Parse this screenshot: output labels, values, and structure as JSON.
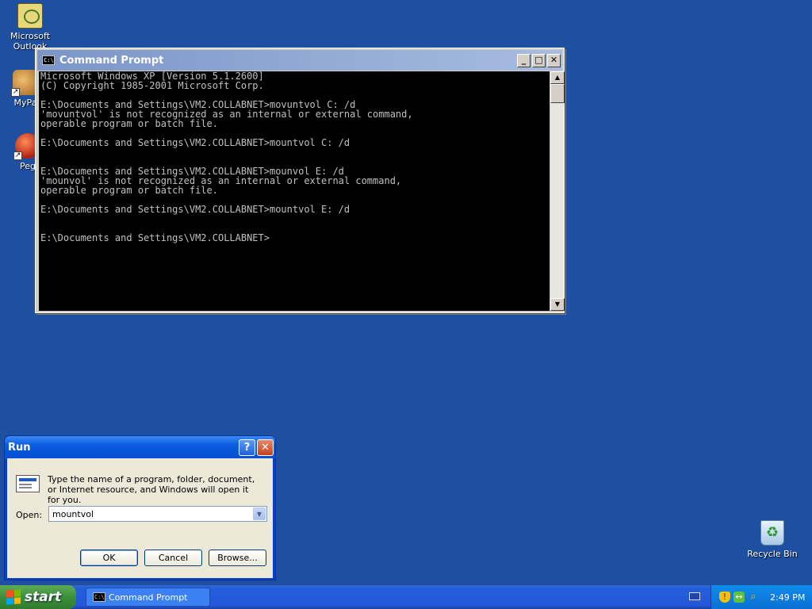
{
  "desktop": {
    "icons": [
      {
        "label": "Microsoft Outlook",
        "icon": "outlook-icon"
      },
      {
        "label": "MyPa",
        "icon": "shortcut-icon"
      },
      {
        "label": "Peg",
        "icon": "shortcut-icon"
      },
      {
        "label": "Recycle Bin",
        "icon": "recycle-bin-icon"
      }
    ]
  },
  "cmd_window": {
    "title": "Command Prompt",
    "icon_text": "C:\\",
    "buttons": {
      "minimize": "_",
      "maximize": "□",
      "close": "✕"
    },
    "output": "Microsoft Windows XP [Version 5.1.2600]\n(C) Copyright 1985-2001 Microsoft Corp.\n\nE:\\Documents and Settings\\VM2.COLLABNET>movuntvol C: /d\n'movuntvol' is not recognized as an internal or external command,\noperable program or batch file.\n\nE:\\Documents and Settings\\VM2.COLLABNET>mountvol C: /d\n\n\nE:\\Documents and Settings\\VM2.COLLABNET>mounvol E: /d\n'mounvol' is not recognized as an internal or external command,\noperable program or batch file.\n\nE:\\Documents and Settings\\VM2.COLLABNET>mountvol E: /d\n\n\nE:\\Documents and Settings\\VM2.COLLABNET>",
    "scroll_up": "▲",
    "scroll_down": "▼"
  },
  "run_dialog": {
    "title": "Run",
    "help_btn": "?",
    "close_btn": "✕",
    "description": "Type the name of a program, folder, document, or Internet resource, and Windows will open it for you.",
    "open_label": "Open:",
    "open_value": "mountvol",
    "dropdown_arrow": "▼",
    "ok_label": "OK",
    "cancel_label": "Cancel",
    "browse_label": "Browse..."
  },
  "taskbar": {
    "start_label": "start",
    "tasks": [
      {
        "label": "Command Prompt",
        "icon": "cmd-icon"
      }
    ],
    "tray_icons": [
      "security-shield-icon",
      "network-icon",
      "search-icon"
    ],
    "clock": "2:49 PM"
  },
  "colors": {
    "desktop_bg": "#1e4fa0",
    "xp_blue": "#0a5ce0",
    "start_green": "#3c8f3b"
  }
}
